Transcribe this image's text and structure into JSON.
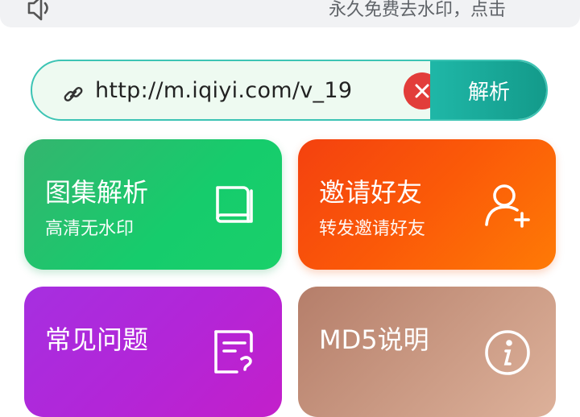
{
  "notice": {
    "text": "永久免费去水印，点击",
    "icon": "speaker-icon"
  },
  "url_input": {
    "value": "http://m.iqiyi.com/v_19",
    "icon": "link-icon",
    "clear_icon": "close-icon",
    "parse_label": "解析"
  },
  "cards": {
    "album": {
      "title": "图集解析",
      "subtitle": "高清无水印",
      "icon": "book-icon",
      "color": "#1cc96c"
    },
    "invite": {
      "title": "邀请好友",
      "subtitle": "转发邀请好友",
      "icon": "add-user-icon",
      "color": "#fb5a08"
    },
    "faq": {
      "title": "常见问题",
      "icon": "faq-list-icon",
      "color": "#b226d8"
    },
    "md5": {
      "title": "MD5说明",
      "icon": "info-icon",
      "color": "#c99882"
    }
  },
  "colors": {
    "accent": "#1fb7a7",
    "clear": "#e23d3a"
  }
}
